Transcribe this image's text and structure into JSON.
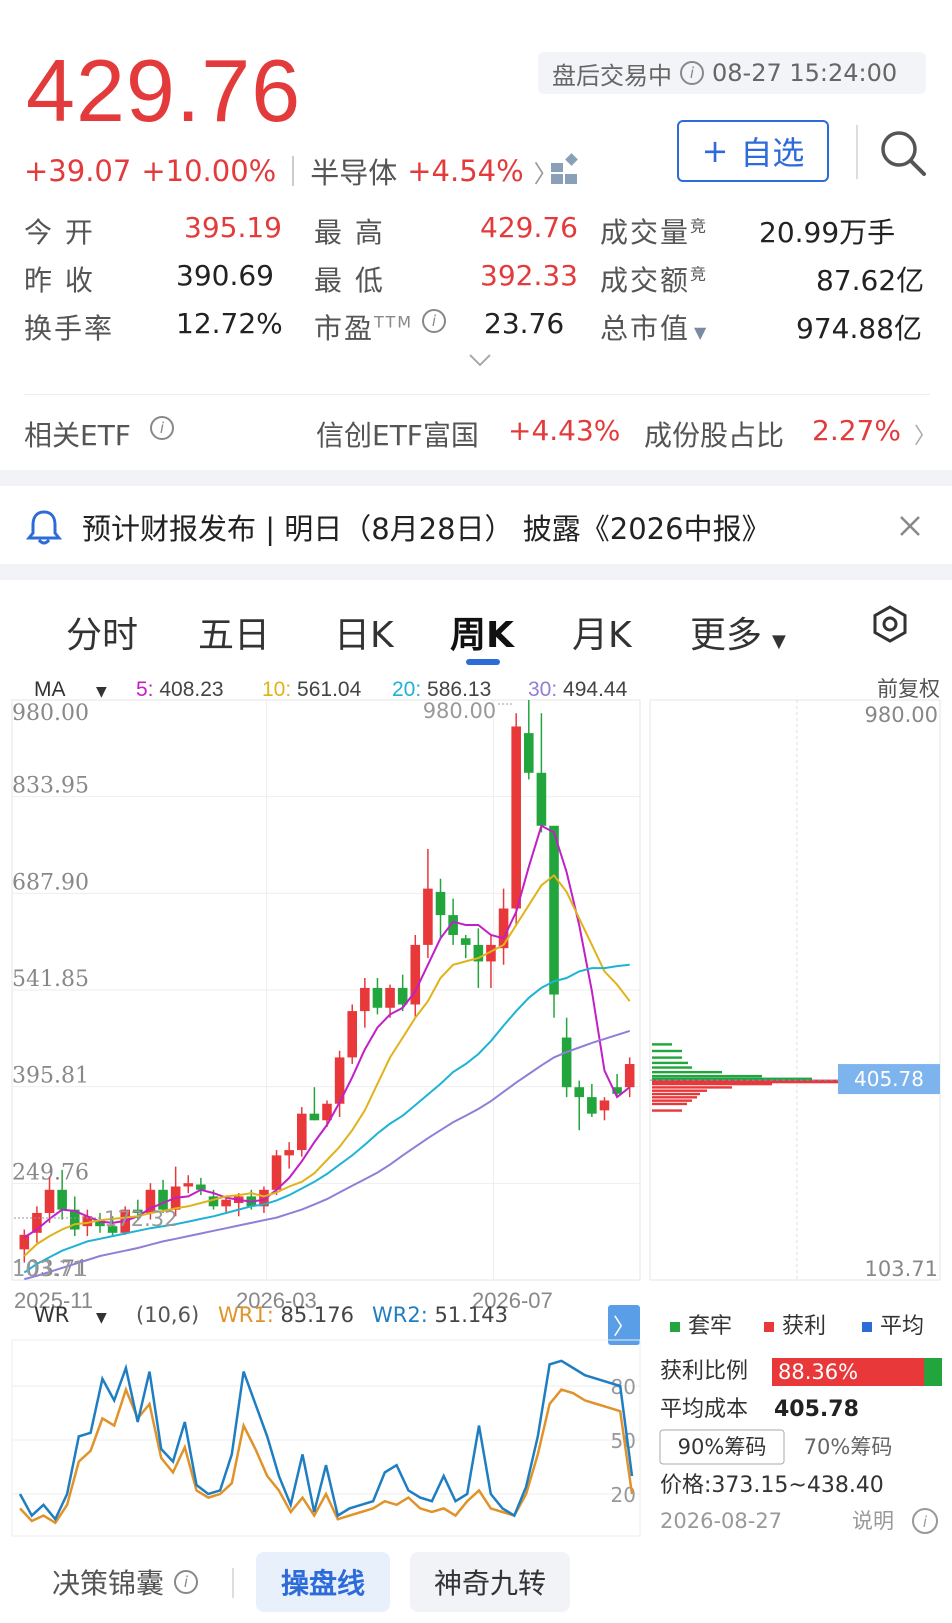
{
  "quote": {
    "price": "429.76",
    "change": "+39.07",
    "change_pct": "+10.00%",
    "sector_name": "半导体",
    "sector_change": "+4.54%",
    "status": "盘后交易中",
    "datetime": "08-27 15:24:00",
    "add_label": "自选",
    "stats": [
      {
        "label": "今  开",
        "value": "395.19",
        "color": "red"
      },
      {
        "label": "最  高",
        "value": "429.76",
        "color": "red"
      },
      {
        "label": "成交量",
        "sup": "竞",
        "value": "20.99万手",
        "color": "black"
      },
      {
        "label": "昨  收",
        "value": "390.69",
        "color": "black"
      },
      {
        "label": "最  低",
        "value": "392.33",
        "color": "red"
      },
      {
        "label": "成交额",
        "sup": "竞",
        "value": "87.62亿",
        "color": "black"
      },
      {
        "label": "换手率",
        "value": "12.72%",
        "color": "black"
      },
      {
        "label": "市盈",
        "sup": "TTM",
        "value": "23.76",
        "color": "black"
      },
      {
        "label": "总市值",
        "value": "974.88亿",
        "color": "black"
      }
    ]
  },
  "etf": {
    "label": "相关ETF",
    "name": "信创ETF富国",
    "change": "+4.43%",
    "share_label": "成份股占比",
    "share_value": "2.27%"
  },
  "notice": {
    "text": "预计财报发布 | 明日（8月28日） 披露《2026中报》"
  },
  "tabs": [
    {
      "label": "分时"
    },
    {
      "label": "五日"
    },
    {
      "label": "日K"
    },
    {
      "label": "周K",
      "active": true
    },
    {
      "label": "月K"
    },
    {
      "label": "更多"
    }
  ],
  "ma_bar": {
    "selector": "MA",
    "ma5": "5: 408.23",
    "ma10": "10: 561.04",
    "ma20": "20: 586.13",
    "ma30": "30: 494.44",
    "adjust": "前复权",
    "colors": {
      "ma5": "#c21fc7",
      "ma10": "#e0b31a",
      "ma20": "#1eb3d4",
      "ma30": "#8f7fd6"
    }
  },
  "chart_data": [
    {
      "type": "candlestick",
      "title": "周K",
      "y_ticks": [
        "980.00",
        "833.95",
        "687.90",
        "541.85",
        "395.81",
        "249.76",
        "103.71"
      ],
      "ylim": [
        103.71,
        980.0
      ],
      "x_ticks": [
        "2025-11",
        "2026-03",
        "2026-07"
      ],
      "annotations": {
        "high": "980.00",
        "low": "172.32",
        "low_left": "103.71",
        "right_top": "980.00",
        "right_bottom": "103.71"
      },
      "candles": [
        {
          "o": 150,
          "h": 180,
          "l": 130,
          "c": 172
        },
        {
          "o": 175,
          "h": 215,
          "l": 160,
          "c": 205
        },
        {
          "o": 205,
          "h": 260,
          "l": 190,
          "c": 240
        },
        {
          "o": 240,
          "h": 270,
          "l": 195,
          "c": 210
        },
        {
          "o": 210,
          "h": 230,
          "l": 170,
          "c": 180
        },
        {
          "o": 185,
          "h": 210,
          "l": 170,
          "c": 200
        },
        {
          "o": 195,
          "h": 205,
          "l": 175,
          "c": 185
        },
        {
          "o": 185,
          "h": 200,
          "l": 170,
          "c": 175
        },
        {
          "o": 175,
          "h": 215,
          "l": 172,
          "c": 210
        },
        {
          "o": 210,
          "h": 225,
          "l": 195,
          "c": 205
        },
        {
          "o": 205,
          "h": 250,
          "l": 195,
          "c": 240
        },
        {
          "o": 240,
          "h": 255,
          "l": 205,
          "c": 210
        },
        {
          "o": 210,
          "h": 275,
          "l": 200,
          "c": 245
        },
        {
          "o": 245,
          "h": 262,
          "l": 235,
          "c": 250
        },
        {
          "o": 248,
          "h": 258,
          "l": 232,
          "c": 240
        },
        {
          "o": 230,
          "h": 240,
          "l": 210,
          "c": 215
        },
        {
          "o": 215,
          "h": 230,
          "l": 205,
          "c": 225
        },
        {
          "o": 220,
          "h": 235,
          "l": 200,
          "c": 230
        },
        {
          "o": 230,
          "h": 240,
          "l": 210,
          "c": 215
        },
        {
          "o": 215,
          "h": 245,
          "l": 205,
          "c": 240
        },
        {
          "o": 240,
          "h": 300,
          "l": 232,
          "c": 292
        },
        {
          "o": 292,
          "h": 312,
          "l": 272,
          "c": 300
        },
        {
          "o": 300,
          "h": 365,
          "l": 290,
          "c": 355
        },
        {
          "o": 355,
          "h": 395,
          "l": 345,
          "c": 345
        },
        {
          "o": 345,
          "h": 375,
          "l": 335,
          "c": 370
        },
        {
          "o": 370,
          "h": 450,
          "l": 350,
          "c": 440
        },
        {
          "o": 440,
          "h": 520,
          "l": 430,
          "c": 510
        },
        {
          "o": 510,
          "h": 560,
          "l": 485,
          "c": 545
        },
        {
          "o": 545,
          "h": 560,
          "l": 505,
          "c": 515
        },
        {
          "o": 515,
          "h": 550,
          "l": 500,
          "c": 545
        },
        {
          "o": 545,
          "h": 565,
          "l": 510,
          "c": 520
        },
        {
          "o": 520,
          "h": 625,
          "l": 500,
          "c": 610
        },
        {
          "o": 610,
          "h": 755,
          "l": 590,
          "c": 695
        },
        {
          "o": 690,
          "h": 710,
          "l": 620,
          "c": 655
        },
        {
          "o": 655,
          "h": 680,
          "l": 610,
          "c": 625
        },
        {
          "o": 620,
          "h": 625,
          "l": 590,
          "c": 610
        },
        {
          "o": 610,
          "h": 635,
          "l": 545,
          "c": 585
        },
        {
          "o": 585,
          "h": 625,
          "l": 545,
          "c": 610
        },
        {
          "o": 605,
          "h": 695,
          "l": 580,
          "c": 665
        },
        {
          "o": 665,
          "h": 960,
          "l": 640,
          "c": 940
        },
        {
          "o": 930,
          "h": 980,
          "l": 860,
          "c": 870
        },
        {
          "o": 870,
          "h": 960,
          "l": 780,
          "c": 790
        },
        {
          "o": 790,
          "h": 780,
          "l": 500,
          "c": 535
        },
        {
          "o": 470,
          "h": 500,
          "l": 380,
          "c": 395
        },
        {
          "o": 395,
          "h": 405,
          "l": 330,
          "c": 380
        },
        {
          "o": 380,
          "h": 400,
          "l": 350,
          "c": 355
        },
        {
          "o": 360,
          "h": 380,
          "l": 345,
          "c": 375
        },
        {
          "o": 395,
          "h": 415,
          "l": 380,
          "c": 385
        },
        {
          "o": 395,
          "h": 440,
          "l": 380,
          "c": 430
        }
      ],
      "series": [
        {
          "name": "5",
          "color": "#c21fc7",
          "values": [
            168,
            180,
            196,
            210,
            208,
            200,
            192,
            190,
            193,
            200,
            212,
            220,
            228,
            230,
            240,
            235,
            228,
            225,
            222,
            225,
            240,
            258,
            283,
            312,
            338,
            372,
            410,
            452,
            485,
            505,
            515,
            540,
            580,
            620,
            645,
            640,
            640,
            625,
            620,
            660,
            728,
            790,
            780,
            720,
            640,
            540,
            420,
            380,
            395
          ]
        },
        {
          "name": "10",
          "color": "#e0b31a",
          "values": [
            140,
            158,
            170,
            180,
            188,
            190,
            194,
            196,
            198,
            200,
            205,
            208,
            212,
            215,
            220,
            225,
            230,
            232,
            235,
            230,
            236,
            245,
            252,
            265,
            285,
            305,
            330,
            360,
            400,
            440,
            470,
            500,
            525,
            560,
            580,
            585,
            590,
            600,
            610,
            640,
            670,
            700,
            715,
            690,
            650,
            610,
            570,
            550,
            525
          ]
        },
        {
          "name": "20",
          "color": "#1eb3d4",
          "values": [
            115,
            128,
            138,
            148,
            155,
            162,
            166,
            170,
            174,
            178,
            182,
            185,
            188,
            192,
            196,
            200,
            205,
            210,
            215,
            218,
            224,
            232,
            242,
            252,
            264,
            278,
            292,
            308,
            325,
            340,
            352,
            368,
            384,
            400,
            418,
            430,
            445,
            465,
            488,
            510,
            530,
            545,
            555,
            560,
            570,
            575,
            575,
            578,
            580
          ]
        },
        {
          "name": "30",
          "color": "#8f7fd6",
          "values": [
            105,
            110,
            116,
            122,
            128,
            134,
            140,
            144,
            148,
            152,
            157,
            162,
            166,
            170,
            174,
            178,
            182,
            186,
            190,
            194,
            198,
            204,
            210,
            218,
            226,
            236,
            246,
            256,
            266,
            278,
            292,
            305,
            318,
            330,
            342,
            352,
            362,
            374,
            388,
            402,
            415,
            428,
            440,
            448,
            455,
            462,
            468,
            474,
            480
          ]
        }
      ],
      "chips": {
        "legend": [
          "套牢",
          "获利",
          "平均"
        ],
        "profit_label": "获利比例",
        "profit_value": "88.36%",
        "profit_fraction": 0.8836,
        "avg_cost_label": "平均成本",
        "avg_cost_value": "405.78",
        "avg_tag": "405.78",
        "btn90": "90%筹码",
        "btn70": "70%筹码",
        "range": "价格:373.15~438.40",
        "date": "2026-08-27",
        "explain": "说明"
      }
    },
    {
      "type": "line",
      "title": "WR",
      "params": "(10,6)",
      "wr1_label": "WR1: 85.176",
      "wr2_label": "WR2: 51.143",
      "y_ticks": [
        "80",
        "50",
        "20"
      ],
      "ylim": [
        0,
        100
      ],
      "series": [
        {
          "name": "WR1",
          "color": "#e0932a",
          "values": [
            12,
            5,
            8,
            4,
            14,
            38,
            44,
            62,
            58,
            78,
            62,
            70,
            40,
            32,
            46,
            22,
            18,
            20,
            26,
            58,
            45,
            30,
            22,
            10,
            18,
            8,
            20,
            6,
            8,
            10,
            12,
            16,
            14,
            18,
            12,
            10,
            12,
            8,
            16,
            22,
            12,
            10,
            8,
            20,
            42,
            70,
            78,
            76,
            72,
            70,
            68,
            66,
            20
          ]
        },
        {
          "name": "WR2",
          "color": "#1f7ec2",
          "values": [
            20,
            8,
            14,
            6,
            20,
            52,
            54,
            84,
            72,
            90,
            60,
            88,
            45,
            38,
            60,
            25,
            20,
            22,
            42,
            88,
            70,
            52,
            30,
            14,
            42,
            10,
            36,
            8,
            12,
            14,
            16,
            32,
            36,
            22,
            18,
            16,
            30,
            16,
            20,
            58,
            20,
            12,
            8,
            24,
            52,
            92,
            94,
            90,
            86,
            84,
            82,
            80,
            30
          ]
        }
      ]
    }
  ],
  "wr_bar": {
    "selector": "WR",
    "params": "(10,6)",
    "wr1": "WR1: 85.176",
    "wr2": "WR2: 51.143"
  },
  "bottom_tabs": [
    {
      "label": "决策锦囊"
    },
    {
      "label": "操盘线",
      "active": true
    },
    {
      "label": "神奇九转"
    }
  ]
}
